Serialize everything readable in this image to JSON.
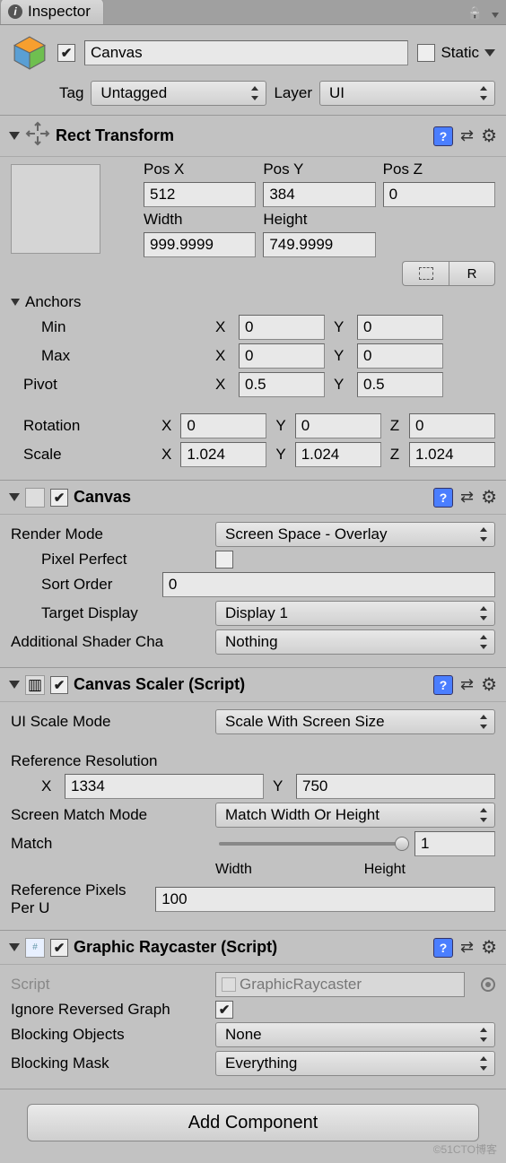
{
  "inspector": {
    "title": "Inspector"
  },
  "object": {
    "name": "Canvas",
    "static_label": "Static",
    "enabled": true,
    "static": false
  },
  "taglayer": {
    "tag_label": "Tag",
    "tag_value": "Untagged",
    "layer_label": "Layer",
    "layer_value": "UI"
  },
  "rect": {
    "title": "Rect Transform",
    "posx_label": "Pos X",
    "posy_label": "Pos Y",
    "posz_label": "Pos Z",
    "posx": "512",
    "posy": "384",
    "posz": "0",
    "width_label": "Width",
    "height_label": "Height",
    "width": "999.9999",
    "height": "749.9999",
    "r_label": "R",
    "anchors_label": "Anchors",
    "min_label": "Min",
    "max_label": "Max",
    "pivot_label": "Pivot",
    "rotation_label": "Rotation",
    "scale_label": "Scale",
    "x": "X",
    "y": "Y",
    "z": "Z",
    "min_x": "0",
    "min_y": "0",
    "max_x": "0",
    "max_y": "0",
    "pivot_x": "0.5",
    "pivot_y": "0.5",
    "rot_x": "0",
    "rot_y": "0",
    "rot_z": "0",
    "scale_x": "1.024",
    "scale_y": "1.024",
    "scale_z": "1.024"
  },
  "canvas": {
    "title": "Canvas",
    "render_mode_label": "Render Mode",
    "render_mode": "Screen Space - Overlay",
    "pixel_perfect_label": "Pixel Perfect",
    "pixel_perfect": false,
    "sort_order_label": "Sort Order",
    "sort_order": "0",
    "target_display_label": "Target Display",
    "target_display": "Display 1",
    "shader_channels_label": "Additional Shader Cha",
    "shader_channels": "Nothing"
  },
  "scaler": {
    "title": "Canvas Scaler (Script)",
    "scale_mode_label": "UI Scale Mode",
    "scale_mode": "Scale With Screen Size",
    "ref_res_label": "Reference Resolution",
    "x_label": "X",
    "y_label": "Y",
    "ref_x": "1334",
    "ref_y": "750",
    "match_mode_label": "Screen Match Mode",
    "match_mode": "Match Width Or Height",
    "match_label": "Match",
    "match_value": "1",
    "match_width": "Width",
    "match_height": "Height",
    "ref_pixels_label": "Reference Pixels Per U",
    "ref_pixels": "100"
  },
  "raycaster": {
    "title": "Graphic Raycaster (Script)",
    "script_label": "Script",
    "script_value": "GraphicRaycaster",
    "ignore_label": "Ignore Reversed Graph",
    "ignore": true,
    "blocking_obj_label": "Blocking Objects",
    "blocking_obj": "None",
    "blocking_mask_label": "Blocking Mask",
    "blocking_mask": "Everything"
  },
  "add_component": "Add Component",
  "watermark": "©51CTO博客"
}
